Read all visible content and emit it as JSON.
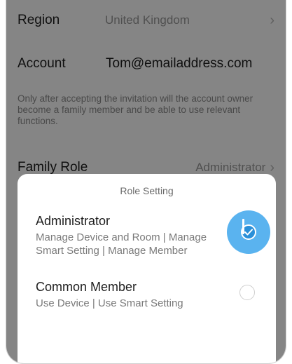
{
  "settings": {
    "region": {
      "label": "Region",
      "value": "United Kingdom"
    },
    "account": {
      "label": "Account",
      "value": "Tom@emailaddress.com"
    },
    "notice": "Only after accepting the invitation will the account owner become a family member and be able to use relevant functions.",
    "family_role": {
      "label": "Family Role",
      "value": "Administrator"
    }
  },
  "dialog": {
    "title": "Role Setting",
    "options": [
      {
        "title": "Administrator",
        "description": "Manage Device and Room | Manage Smart Setting | Manage Member",
        "selected": true
      },
      {
        "title": "Common Member",
        "description": "Use Device | Use Smart Setting",
        "selected": false
      }
    ]
  },
  "colors": {
    "overlay": "rgba(0,0,0,0.48)",
    "accent": "#2a8fd8",
    "accent_highlight": "#5ab3ef"
  }
}
